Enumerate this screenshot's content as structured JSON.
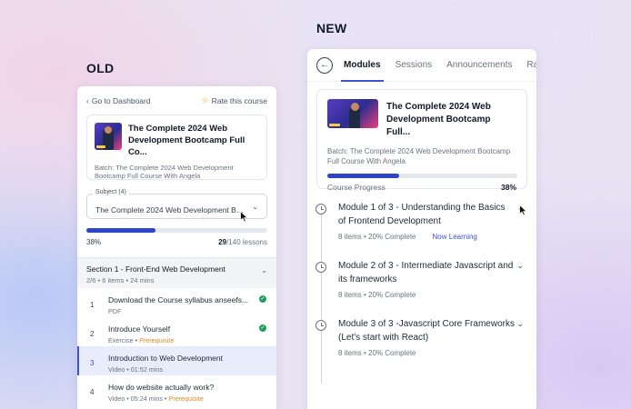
{
  "labels": {
    "old": "OLD",
    "new": "NEW"
  },
  "old": {
    "back_link": "Go to Dashboard",
    "rate_link": "Rate this course",
    "course": {
      "title": "The Complete 2024 Web Development Bootcamp Full Co...",
      "batch": "Batch: The Complete 2024 Web Development Bootcamp Full Course With Angela"
    },
    "subject": {
      "label": "Subject (4)",
      "value": "The Complete 2024 Web Development Bo..."
    },
    "progress": {
      "fraction": 0.38,
      "percent_text": "38%",
      "lessons_done": "29",
      "lessons_total": "/140 lessons"
    },
    "section": {
      "title": "Section 1 - Front-End Web Development",
      "meta": "2/6 • 6 items • 24 mins"
    },
    "lessons": [
      {
        "num": "1",
        "title": "Download the Course syllabus anseefs...",
        "type": "PDF",
        "extra": "",
        "done": true
      },
      {
        "num": "2",
        "title": "Introduce Yourself",
        "type": "Exercise • ",
        "extra": "Prerequisite",
        "done": true
      },
      {
        "num": "3",
        "title": "Introduction to Web Development",
        "type": "Video • 01:52 mins",
        "extra": "",
        "done": false
      },
      {
        "num": "4",
        "title": "How do website actually work?",
        "type": "Video • 05:24 mins • ",
        "extra": "Prerequisite",
        "done": false
      }
    ]
  },
  "new": {
    "tabs": [
      "Modules",
      "Sessions",
      "Announcements",
      "Ra"
    ],
    "active_tab": "Modules",
    "course": {
      "title": "The Complete 2024 Web Development Bootcamp Full...",
      "batch": "Batch: The Complete 2024 Web Development Bootcamp Full Course With Angela"
    },
    "progress": {
      "label": "Course Progress",
      "fraction": 0.38,
      "percent_text": "38%"
    },
    "modules": [
      {
        "title": "Module 1 of 3 - Understanding the Basics of Frontend Development",
        "meta": "8 items • 20% Complete",
        "status": "Now Learning"
      },
      {
        "title": "Module 2 of 3 - Intermediate Javascript and its frameworks",
        "meta": "8 items • 20% Complete",
        "status": ""
      },
      {
        "title": "Module 3 of 3 -Javascript Core Frameworks (Let's start with React)",
        "meta": "8 items • 20% Complete",
        "status": ""
      }
    ]
  },
  "colors": {
    "accent": "#3b53d1",
    "progress_fill": "#2b44c8",
    "success": "#22a05a",
    "prerequisite": "#e58a1b",
    "rating_star": "#e0a100"
  }
}
